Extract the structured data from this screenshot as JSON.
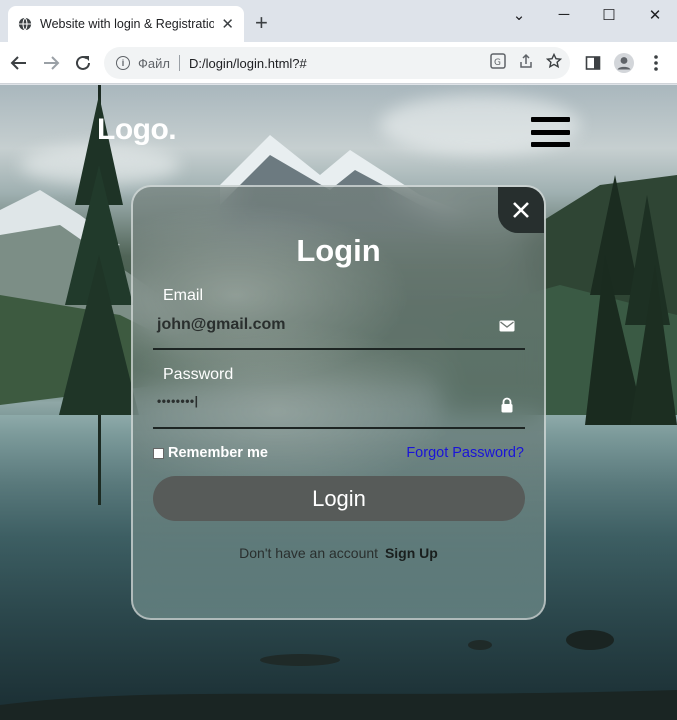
{
  "browser": {
    "tab_title": "Website with login & Registration",
    "tab_close": "✕",
    "new_tab": "+",
    "omnibox_label": "Файл",
    "url": "D:/login/login.html?#",
    "window_controls": {
      "minimize": "─",
      "maximize": "☐",
      "close": "✕",
      "tab_list": "⌄"
    }
  },
  "header": {
    "logo": "Logo."
  },
  "login": {
    "title": "Login",
    "email_label": "Email",
    "email_value": "john@gmail.com",
    "password_label": "Password",
    "password_value": "••••••••|",
    "remember_label": "Remember me",
    "forgot_link": "Forgot Password?",
    "submit_label": "Login",
    "signup_prompt": "Don't have an account",
    "signup_link": "Sign Up"
  },
  "colors": {
    "forgot_link": "#1a14d8",
    "login_button": "#575b59",
    "close_button": "#272f2e"
  }
}
